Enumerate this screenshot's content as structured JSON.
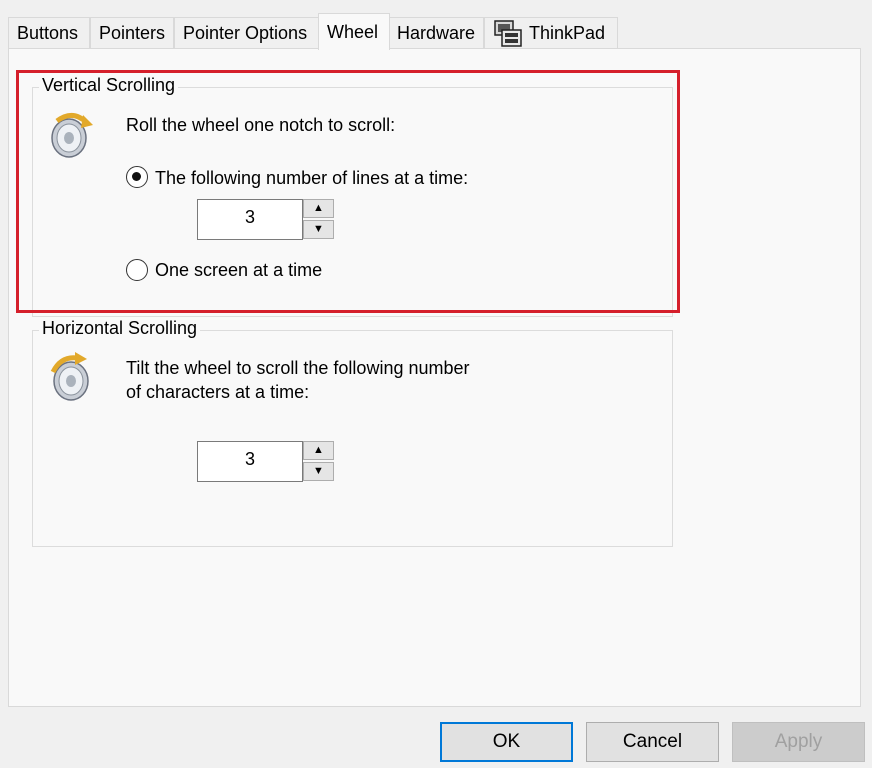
{
  "tabs": [
    {
      "label": "Buttons"
    },
    {
      "label": "Pointers"
    },
    {
      "label": "Pointer Options"
    },
    {
      "label": "Wheel",
      "active": true
    },
    {
      "label": "Hardware"
    },
    {
      "label": "ThinkPad",
      "icon": "thinkpad-icon"
    }
  ],
  "vertical": {
    "title": "Vertical Scrolling",
    "icon": "mouse-wheel-icon",
    "description": "Roll the wheel one notch to scroll:",
    "option_lines": "The following number of lines at a time:",
    "option_lines_selected": true,
    "lines_value": "3",
    "option_screen": "One screen at a time",
    "option_screen_selected": false
  },
  "horizontal": {
    "title": "Horizontal Scrolling",
    "icon": "mouse-wheel-tilt-icon",
    "description_line1": "Tilt the wheel to scroll the following number",
    "description_line2": "of characters at a time:",
    "chars_value": "3"
  },
  "buttons": {
    "ok": "OK",
    "cancel": "Cancel",
    "apply": "Apply"
  },
  "colors": {
    "highlight": "#d51f2b",
    "default_button_border": "#0078d7"
  }
}
